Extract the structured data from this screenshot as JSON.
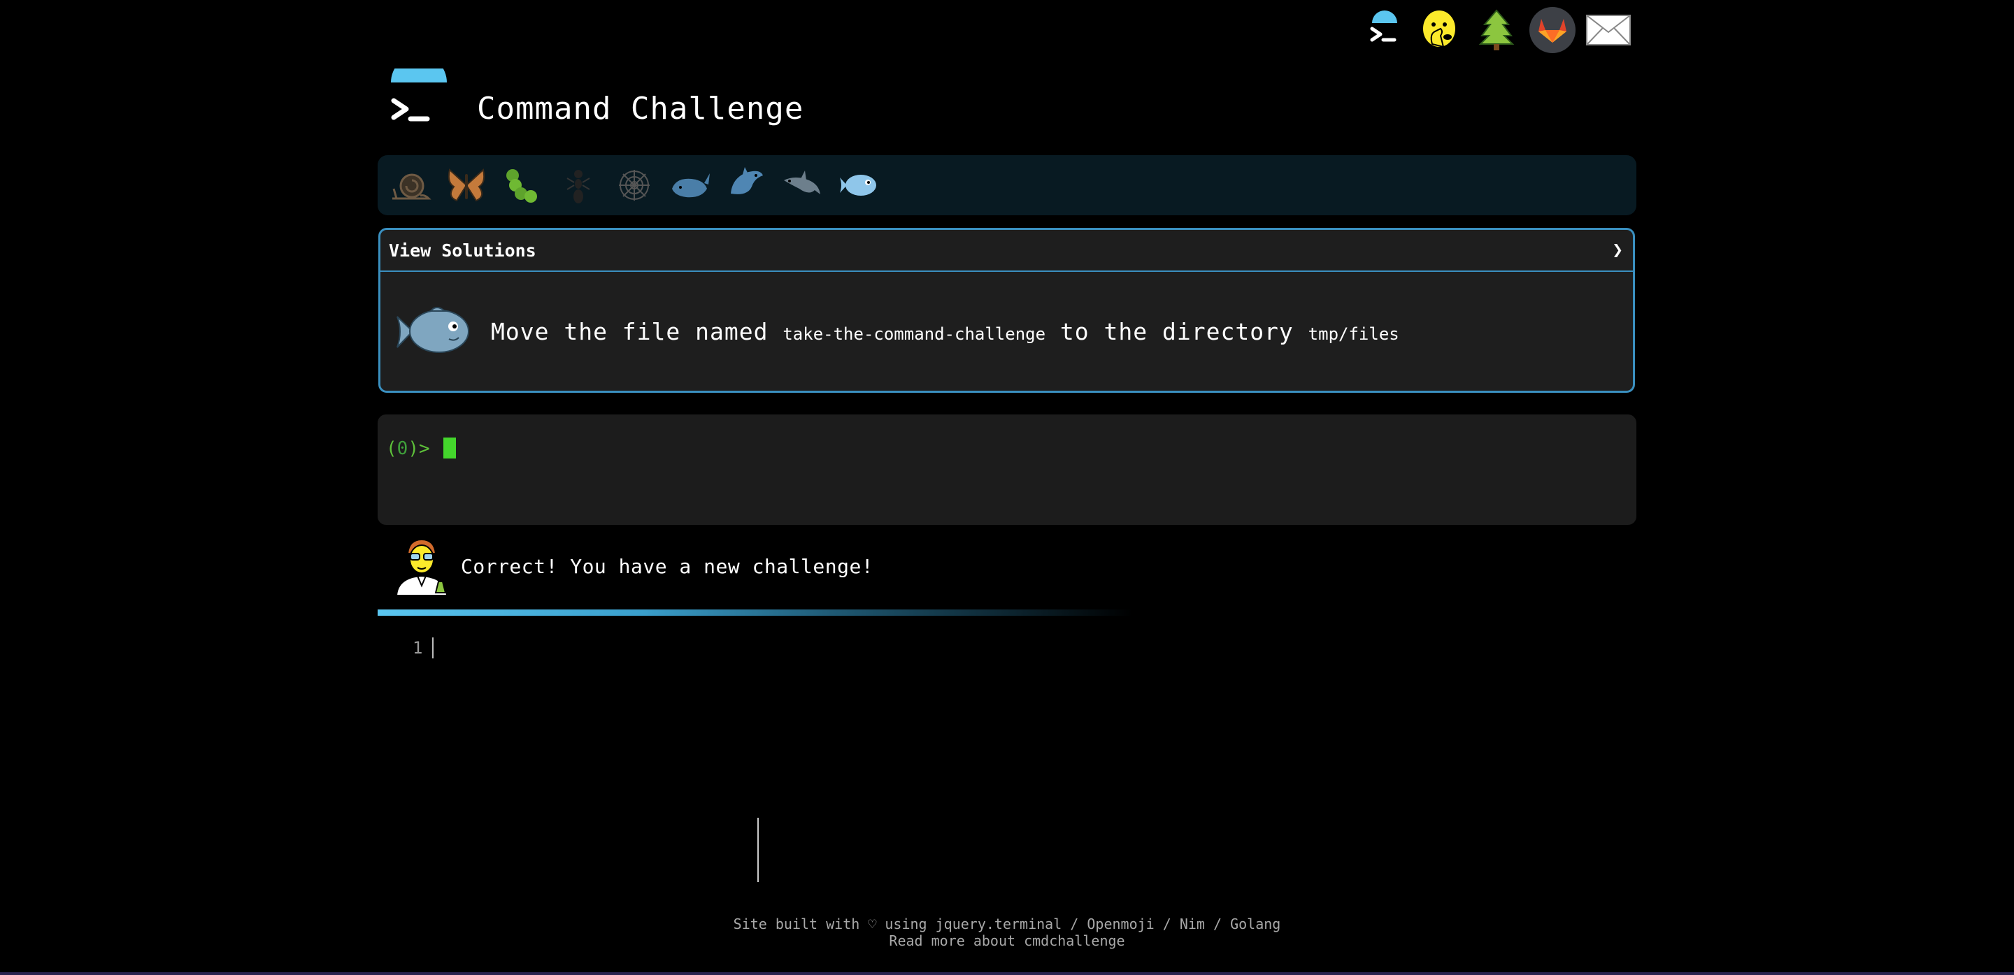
{
  "topnav": {
    "items": [
      {
        "name": "terminal-logo",
        "icon": "terminal-icon"
      },
      {
        "name": "shushing-face",
        "icon": "shushing-face-icon"
      },
      {
        "name": "tree",
        "icon": "tree-icon"
      },
      {
        "name": "gitlab",
        "icon": "gitlab-icon"
      },
      {
        "name": "mail",
        "icon": "envelope-icon"
      }
    ]
  },
  "header": {
    "title": "Command Challenge"
  },
  "levels": [
    {
      "icon": "snail-icon"
    },
    {
      "icon": "butterfly-icon"
    },
    {
      "icon": "caterpillar-icon"
    },
    {
      "icon": "ant-icon"
    },
    {
      "icon": "spider-web-icon"
    },
    {
      "icon": "whale-icon"
    },
    {
      "icon": "shark-icon"
    },
    {
      "icon": "dolphin-icon"
    },
    {
      "icon": "fish-icon"
    }
  ],
  "challenge": {
    "toggle_label": "View Solutions",
    "chevron": "❯",
    "desc_part1": "Move the file named ",
    "file": "take-the-command-challenge",
    "desc_part2": " to the directory ",
    "dir": "tmp/files"
  },
  "terminal": {
    "prompt_open": "(",
    "prompt_num": "0",
    "prompt_close": ")> "
  },
  "status": {
    "message": "Correct! You have a new challenge!"
  },
  "editor": {
    "line_number": "1"
  },
  "footer": {
    "line1": "Site built with ♡ using jquery.terminal / Openmoji / Nim / Golang",
    "line2": "Read more about cmdchallenge"
  },
  "colors": {
    "accent": "#3a8fbf",
    "prompt_green": "#5ec13a",
    "cursor_green": "#44d62c",
    "level_bar": "#081a22"
  }
}
